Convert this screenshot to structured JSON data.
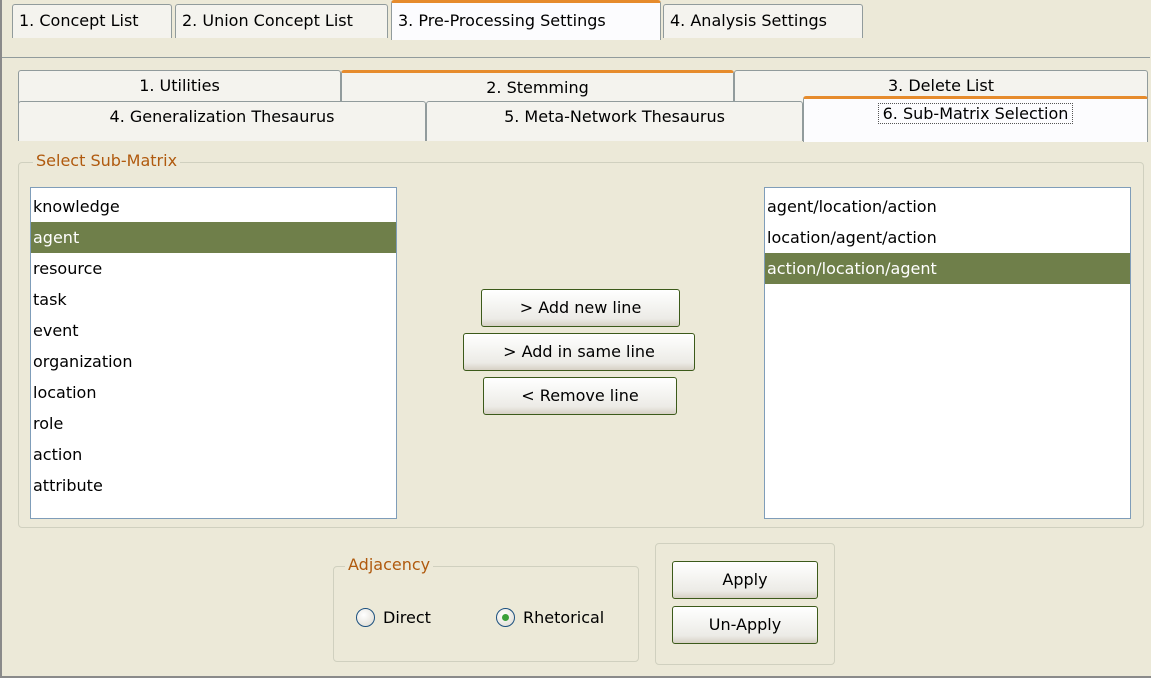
{
  "top_tabs": [
    {
      "label": "1. Concept List"
    },
    {
      "label": "2. Union Concept List"
    },
    {
      "label": "3. Pre-Processing Settings"
    },
    {
      "label": "4. Analysis Settings"
    }
  ],
  "sub_tabs": {
    "row1": [
      {
        "label": "1. Utilities"
      },
      {
        "label": "2. Stemming"
      },
      {
        "label": "3. Delete List"
      }
    ],
    "row2": [
      {
        "label": "4. Generalization Thesaurus"
      },
      {
        "label": "5. Meta-Network Thesaurus"
      },
      {
        "label": "6. Sub-Matrix Selection"
      }
    ]
  },
  "submatrix": {
    "group_title": "Select Sub-Matrix",
    "left_items": [
      "knowledge",
      "agent",
      "resource",
      "task",
      "event",
      "organization",
      "location",
      "role",
      "action",
      "attribute"
    ],
    "left_selected": "agent",
    "right_items": [
      "agent/location/action",
      "location/agent/action",
      "action/location/agent"
    ],
    "right_selected": "action/location/agent",
    "buttons": {
      "add_new_line": "> Add new line",
      "add_in_same_line": "> Add in same line",
      "remove_line": "< Remove line"
    }
  },
  "adjacency": {
    "title": "Adjacency",
    "options": [
      {
        "label": "Direct",
        "selected": false
      },
      {
        "label": "Rhetorical",
        "selected": true
      }
    ]
  },
  "actions": {
    "apply": "Apply",
    "unapply": "Un-Apply"
  },
  "colors": {
    "selection": "#6f7f4a",
    "tab_highlight": "#e68b2c",
    "group_title": "#b05a0e",
    "window_bg": "#ece9d8"
  }
}
